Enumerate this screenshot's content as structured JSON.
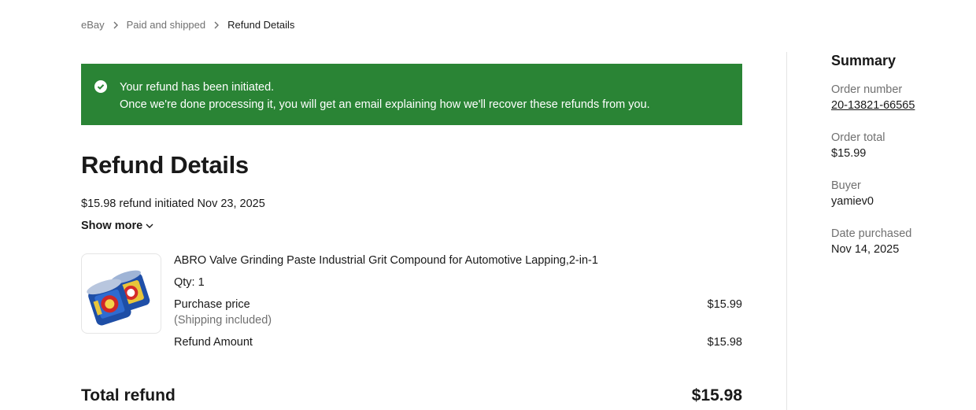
{
  "breadcrumb": {
    "items": [
      "eBay",
      "Paid and shipped"
    ],
    "current": "Refund Details"
  },
  "banner": {
    "line1": "Your refund has been initiated.",
    "line2": "Once we're done processing it, you will get an email explaining how we'll recover these refunds from you.",
    "color": "#2a8435"
  },
  "main": {
    "title": "Refund Details",
    "initiated_text": "$15.98 refund initiated Nov 23, 2025",
    "show_more_label": "Show more"
  },
  "item": {
    "title": "ABRO Valve Grinding Paste Industrial Grit Compound for Automotive Lapping,2-in-1",
    "qty": "Qty: 1",
    "purchase_price_label": "Purchase price",
    "purchase_price_sub": "(Shipping included)",
    "purchase_price_value": "$15.99",
    "refund_amount_label": "Refund Amount",
    "refund_amount_value": "$15.98"
  },
  "total": {
    "label": "Total refund",
    "value": "$15.98"
  },
  "summary": {
    "heading": "Summary",
    "order_number_label": "Order number",
    "order_number_value": "20-13821-66565",
    "order_total_label": "Order total",
    "order_total_value": "$15.99",
    "buyer_label": "Buyer",
    "buyer_value": "yamiev0",
    "date_label": "Date purchased",
    "date_value": "Nov 14, 2025"
  }
}
